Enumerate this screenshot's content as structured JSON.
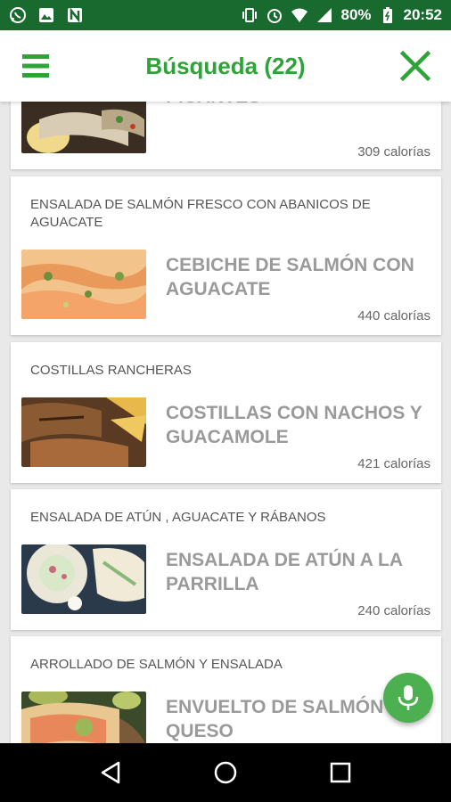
{
  "status_bar": {
    "battery": "80%",
    "time": "20:52"
  },
  "app_bar": {
    "title": "Búsqueda (22)"
  },
  "cards": [
    {
      "subtitle": "",
      "name": "BURRITOS DE POLLO PICANTES",
      "calories": "309 calorías"
    },
    {
      "subtitle": "ENSALADA DE SALMÓN FRESCO CON ABANICOS DE AGUACATE",
      "name": "CEBICHE DE SALMÓN CON AGUACATE",
      "calories": "440 calorías"
    },
    {
      "subtitle": "COSTILLAS RANCHERAS",
      "name": "COSTILLAS CON NACHOS Y GUACAMOLE",
      "calories": "421 calorías"
    },
    {
      "subtitle": "ENSALADA DE ATÚN , AGUACATE Y RÁBANOS",
      "name": "ENSALADA DE ATÚN A LA PARRILLA",
      "calories": "240 calorías"
    },
    {
      "subtitle": "ARROLLADO DE SALMÓN Y ENSALADA",
      "name": "ENVUELTO DE SALMÓN CON QUESO",
      "calories": ""
    }
  ]
}
